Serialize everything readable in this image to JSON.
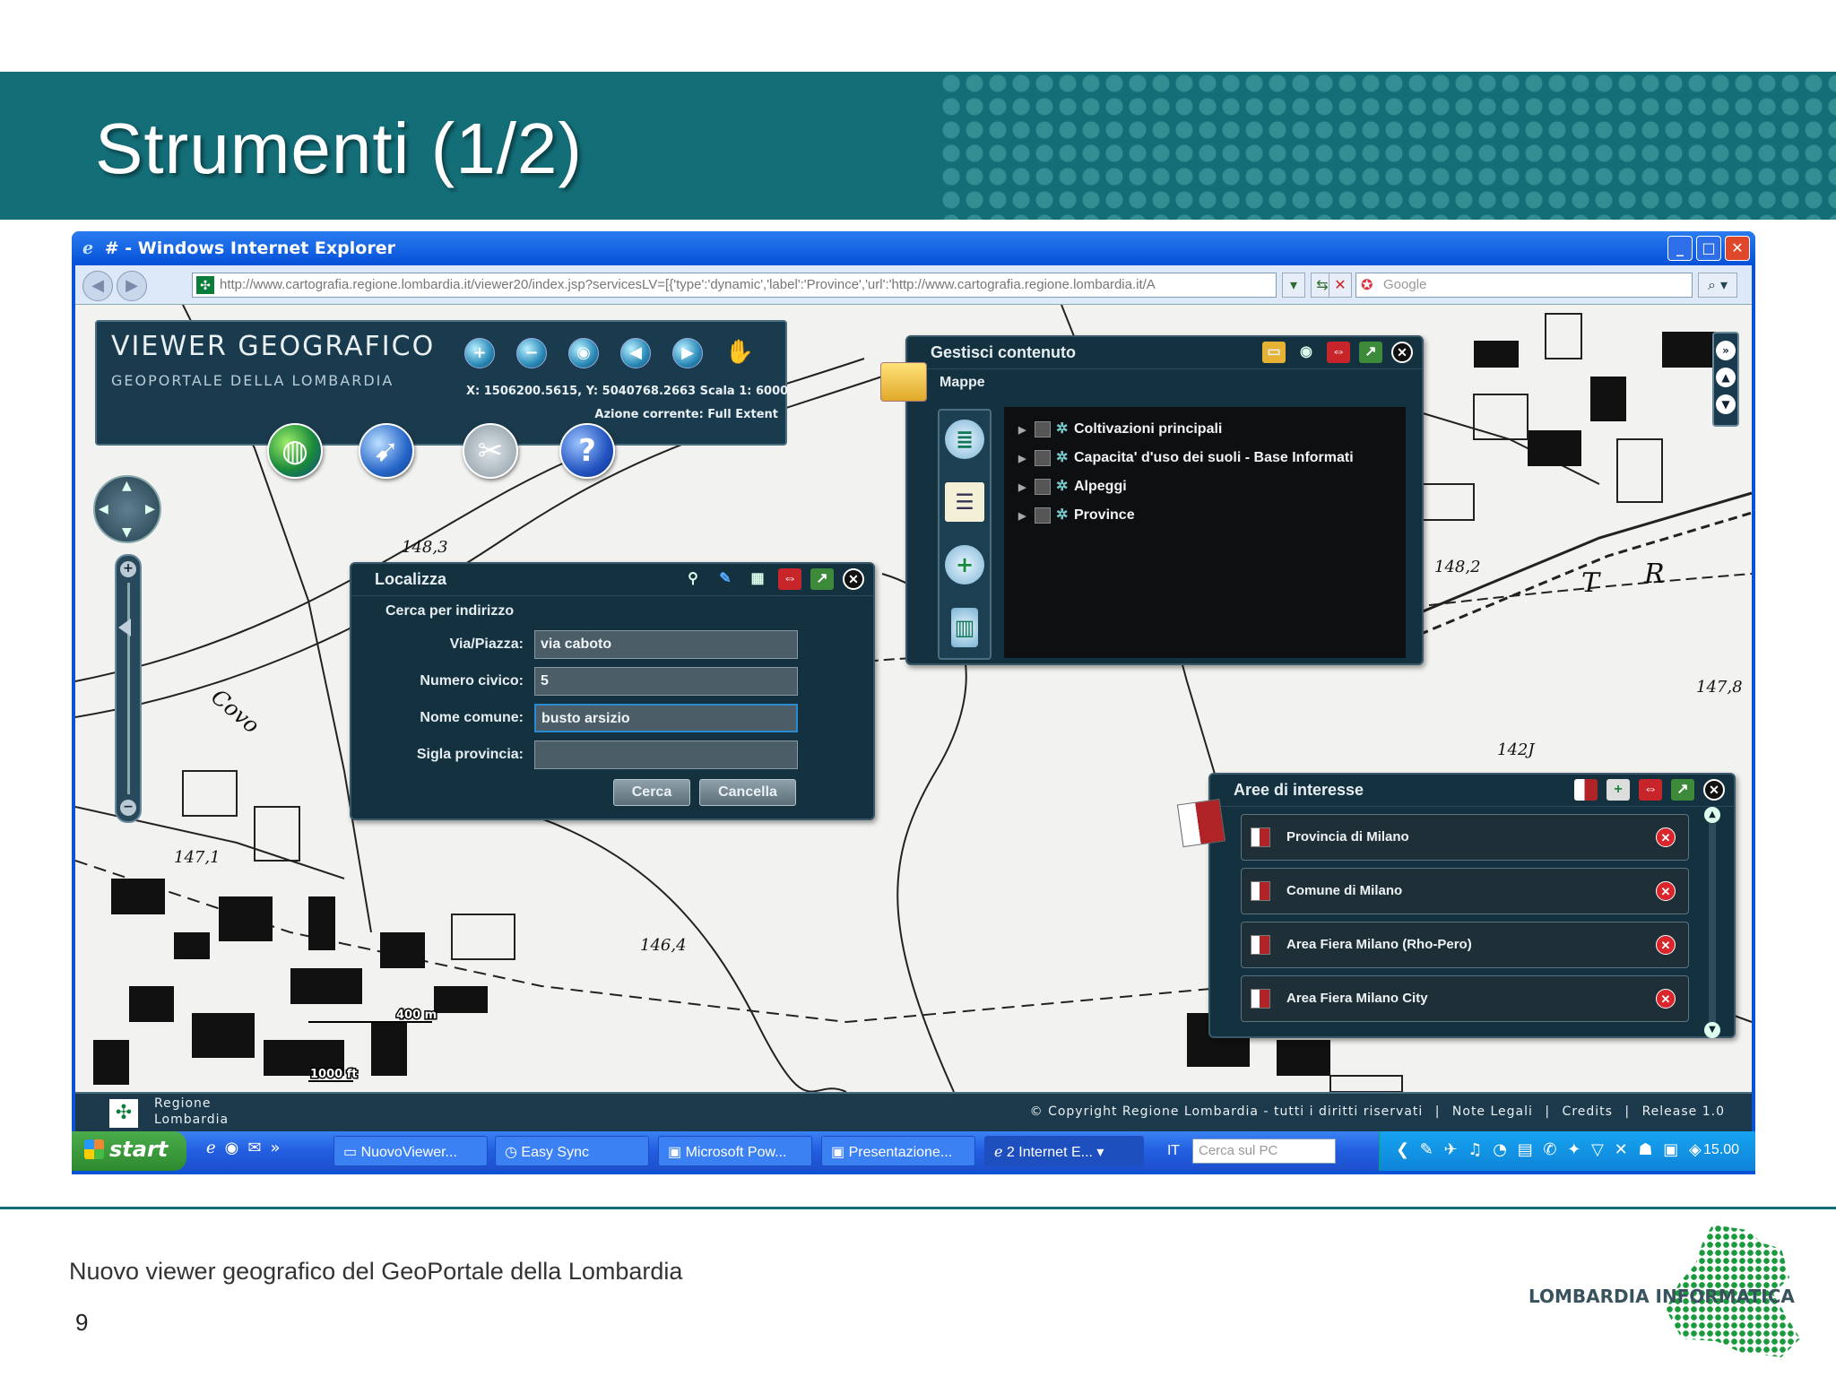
{
  "slide": {
    "title": "Strumenti (1/2)",
    "footer": "Nuovo viewer geografico del GeoPortale della Lombardia",
    "page_number": "9",
    "logo_text": "LOMBARDIA INFORMATICA"
  },
  "browser": {
    "window_title": "# - Windows Internet Explorer",
    "url": "http://www.cartografia.regione.lombardia.it/viewer20/index.jsp?servicesLV=[{'type':'dynamic','label':'Province','url':'http://www.cartografia.regione.lombardia.it/A",
    "search_placeholder": "Google"
  },
  "viewer": {
    "title": "VIEWER GEOGRAFICO",
    "subtitle": "GEOPORTALE DELLA LOMBARDIA",
    "coords": "X: 1506200.5615, Y: 5040768.2663   Scala 1:  6000",
    "action": "Azione corrente: Full Extent"
  },
  "localizza": {
    "title": "Localizza",
    "section": "Cerca per indirizzo",
    "fields": [
      {
        "label": "Via/Piazza:",
        "value": "via caboto"
      },
      {
        "label": "Numero civico:",
        "value": "5"
      },
      {
        "label": "Nome comune:",
        "value": "busto arsizio"
      },
      {
        "label": "Sigla provincia:",
        "value": ""
      }
    ],
    "search_button": "Cerca",
    "cancel_button": "Cancella"
  },
  "gestisci": {
    "title": "Gestisci contenuto",
    "tab": "Mappe",
    "layers": [
      "Coltivazioni principali",
      "Capacita' d'uso dei suoli - Base Informati",
      "Alpeggi",
      "Province"
    ]
  },
  "aree": {
    "title": "Aree di interesse",
    "items": [
      "Provincia di Milano",
      "Comune di Milano",
      "Area Fiera Milano (Rho-Pero)",
      "Area Fiera Milano City"
    ]
  },
  "map_labels": {
    "scale_m": "400 m",
    "scale_ft": "1000 ft",
    "l1": "148,3",
    "l2": "146,4",
    "l3": "147,1",
    "l4": "148,2",
    "l5": "147,8",
    "l6": "142J",
    "l7": "Covo",
    "l8": "T",
    "l9": "R"
  },
  "app_status": {
    "org": "Regione\nLombardia",
    "copyright": "© Copyright Regione Lombardia - tutti i diritti riservati",
    "links": [
      "Note Legali",
      "Credits",
      "Release 1.0"
    ]
  },
  "taskbar": {
    "start": "start",
    "buttons": [
      "NuovoViewer...",
      "Easy Sync",
      "Microsoft Pow...",
      "Presentazione...",
      "2 Internet E..."
    ],
    "lang": "IT",
    "search_placeholder": "Cerca sul PC",
    "clock": "15.00"
  }
}
